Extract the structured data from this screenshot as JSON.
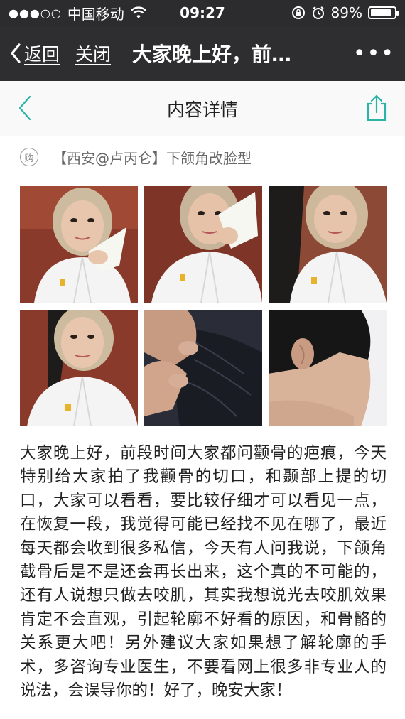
{
  "status_bar": {
    "signal": "●●●○○",
    "carrier": "中国移动",
    "time": "09:27",
    "battery_text": "89%",
    "battery_level": 0.89
  },
  "nav_bar": {
    "back_label": "返回",
    "close_label": "关闭",
    "title": "大家晚上好，前…",
    "more_label": "•••"
  },
  "page_header": {
    "title": "内容详情"
  },
  "tag": {
    "icon_text": "购",
    "text": "【西安@卢丙仑】下颌角改脸型"
  },
  "photos": [
    {
      "name": "photo-1"
    },
    {
      "name": "photo-2"
    },
    {
      "name": "photo-3"
    },
    {
      "name": "photo-4"
    },
    {
      "name": "photo-5"
    },
    {
      "name": "photo-6"
    }
  ],
  "article": {
    "body": "大家晚上好，前段时间大家都问颧骨的疤痕，今天特别给大家拍了我颧骨的切口，和颞部上提的切口，大家可以看看，要比较仔细才可以看见一点，在恢复一段，我觉得可能已经找不见在哪了，最近每天都会收到很多私信，今天有人问我说，下颌角截骨后是不是还会再长出来，这个真的不可能的，还有人说想只做去咬肌，其实我想说光去咬肌效果肯定不会直观，引起轮廓不好看的原因，和骨骼的关系更大吧！另外建议大家如果想了解轮廓的手术，多咨询专业医生，不要看网上很多非专业人的说法，会误导你的！好了，晚安大家！"
  },
  "colors": {
    "accent": "#2ab3a6",
    "nav_bg": "#2e2e30"
  }
}
